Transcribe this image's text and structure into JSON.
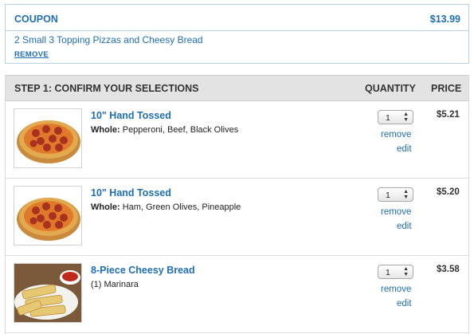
{
  "coupon": {
    "title": "COUPON",
    "price": "$13.99",
    "description": "2 Small 3 Topping Pizzas and Cheesy Bread",
    "remove_label": "REMOVE"
  },
  "table": {
    "step_label": "STEP 1: CONFIRM YOUR SELECTIONS",
    "quantity_label": "QUANTITY",
    "price_label": "PRICE"
  },
  "items": [
    {
      "name": "10\" Hand Tossed",
      "detail_prefix": "Whole:",
      "detail": " Pepperoni, Beef, Black Olives",
      "quantity": "1",
      "remove_label": "remove",
      "edit_label": "edit",
      "price": "$5.21",
      "image": "pepperoni-pizza-image"
    },
    {
      "name": "10\" Hand Tossed",
      "detail_prefix": "Whole:",
      "detail": " Ham, Green Olives, Pineapple",
      "quantity": "1",
      "remove_label": "remove",
      "edit_label": "edit",
      "price": "$5.20",
      "image": "pepperoni-pizza-image"
    },
    {
      "name": "8-Piece Cheesy Bread",
      "detail_prefix": "",
      "detail": "(1) Marinara",
      "quantity": "1",
      "remove_label": "remove",
      "edit_label": "edit",
      "price": "$3.58",
      "image": "cheesy-bread-image"
    }
  ],
  "colors": {
    "link_blue": "#1f6fb2",
    "header_gray": "#e3e3e3"
  }
}
